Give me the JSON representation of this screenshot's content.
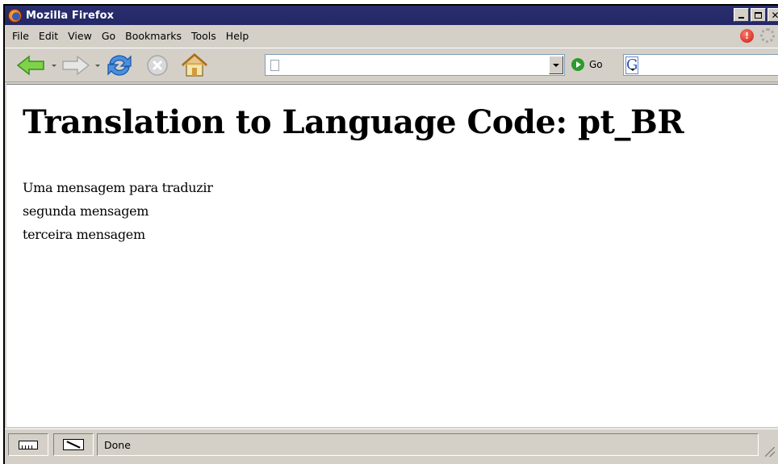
{
  "window": {
    "title": "Mozilla Firefox"
  },
  "menu": {
    "items": [
      "File",
      "Edit",
      "View",
      "Go",
      "Bookmarks",
      "Tools",
      "Help"
    ]
  },
  "toolbar": {
    "icons": [
      "back-icon",
      "forward-icon",
      "reload-icon",
      "stop-icon",
      "home-icon"
    ],
    "url_value": "",
    "go_label": "Go",
    "search_engine": "G",
    "search_value": ""
  },
  "page": {
    "heading": "Translation to Language Code: pt_BR",
    "messages": [
      "Uma mensagem para traduzir",
      "segunda mensagem",
      "terceira mensagem"
    ]
  },
  "status": {
    "text": "Done"
  },
  "colors": {
    "titlebar": "#2a2e6e",
    "chrome": "#d4d0c8",
    "go_green": "#2c9a2c",
    "alert_red": "#c71a12"
  }
}
